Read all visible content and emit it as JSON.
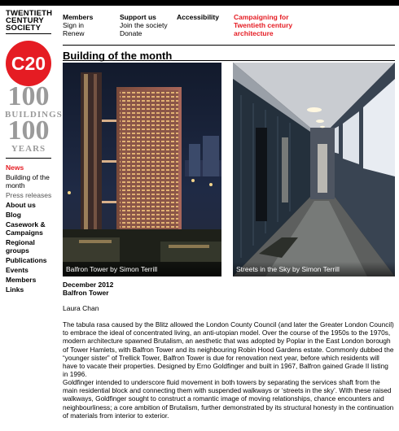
{
  "logo": {
    "line1": "TWENTIETH",
    "line2": "CENTURY",
    "line3": "SOCIETY",
    "c20": "C20",
    "badge_num1": "100",
    "badge_word1": "BUILDINGS",
    "badge_num2": "100",
    "badge_word2": "YEARS"
  },
  "topnav": {
    "members": {
      "heading": "Members",
      "items": [
        "Sign in",
        "Renew"
      ]
    },
    "support": {
      "heading": "Support us",
      "items": [
        "Join the society",
        "Donate"
      ]
    },
    "accessibility": "Accessibility",
    "campaign": "Campaigning for Twentieth century architecture"
  },
  "page_title": "Building of the month",
  "sidebar": {
    "news": "News",
    "building_of_month": "Building of the month",
    "press_releases": "Press releases",
    "about": "About us",
    "blog": "Blog",
    "casework": "Casework & Campaigns",
    "regional": "Regional groups",
    "publications": "Publications",
    "events": "Events",
    "members": "Members",
    "links": "Links"
  },
  "photos": [
    {
      "caption": "Balfron Tower by Simon Terrill"
    },
    {
      "caption": "Streets in the Sky by Simon Terrill"
    }
  ],
  "article": {
    "date": "December 2012",
    "title": "Balfron Tower",
    "author": "Laura Chan",
    "para1": "The tabula rasa caused by the Blitz allowed the London County Council (and later the Greater London Council) to embrace the ideal of concentrated living, an anti-utopian model. Over the course of the 1950s to the 1970s, modern architecture spawned Brutalism, an aesthetic that was adopted by Poplar in the East London borough of Tower Hamlets, with Balfron Tower and its neighbouring Robin Hood Gardens estate. Commonly dubbed the “younger sister” of Trellick Tower, Balfron Tower is due for renovation next year, before which residents will have to vacate their properties. Designed by Erno Goldfinger and built in 1967, Balfron gained Grade II listing in 1996.",
    "para2": "Goldfinger intended to underscore fluid movement in both towers by separating the services shaft from the main residential block and connecting them with suspended walkways or ‘streets in the sky’.  With these raised walkways, Goldfinger sought to construct a romantic image of moving relationships, chance encounters and neighbourliness; a core ambition of Brutalism, further demonstrated by its structural honesty in the continuation of materials from interior to exterior."
  },
  "colors": {
    "accent": "#e51c23",
    "badge_gray": "#9a9a9a"
  }
}
